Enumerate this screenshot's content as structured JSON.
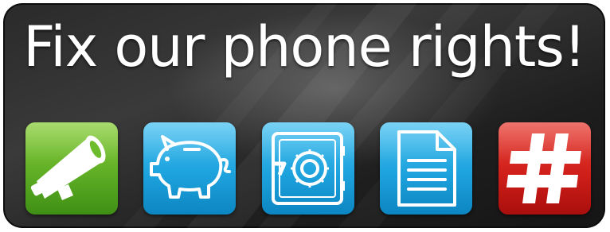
{
  "banner": {
    "title": "Fix our phone rights!",
    "background_color": "#2a2a2a",
    "title_color": "#ffffff"
  },
  "icons": [
    {
      "name": "megaphone-icon",
      "color": "#5fae25"
    },
    {
      "name": "piggy-bank-icon",
      "color": "#1ea3de"
    },
    {
      "name": "safe-icon",
      "color": "#1ea3de"
    },
    {
      "name": "document-icon",
      "color": "#1ea3de"
    },
    {
      "name": "hashtag-icon",
      "color": "#d11f1a"
    }
  ]
}
